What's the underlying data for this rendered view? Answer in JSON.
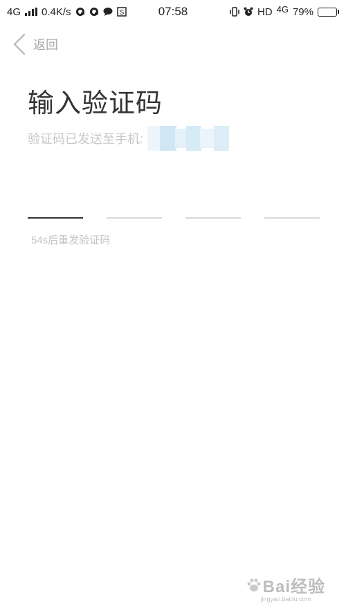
{
  "status_bar": {
    "network_left": "4G",
    "speed": "0.4K/s",
    "time": "07:58",
    "hd": "HD",
    "network_right": "4G",
    "battery": "79%",
    "battery_level": 0.79,
    "icons_left": [
      "signal-icon",
      "qq-icon",
      "qq-icon",
      "chat-bubble-icon",
      "s-app-icon"
    ],
    "icons_right": [
      "vibrate-icon",
      "alarm-icon",
      "signal-icon",
      "battery-icon"
    ]
  },
  "header": {
    "back_label": "返回",
    "back_icon": "chevron-left-icon"
  },
  "main": {
    "title": "输入验证码",
    "sent_text": "验证码已发送至手机:",
    "resend_text": "54s后重发验证码",
    "code_boxes": [
      "",
      "",
      "",
      ""
    ],
    "active_box": 0
  },
  "watermark": {
    "main": "Bai经验",
    "sub": "jingyan.baidu.com"
  },
  "colors": {
    "background": "#ffffff",
    "title": "#333333",
    "muted": "#c8c8c8",
    "active_underline": "#333333",
    "inactive_underline": "#d8d8d8"
  }
}
